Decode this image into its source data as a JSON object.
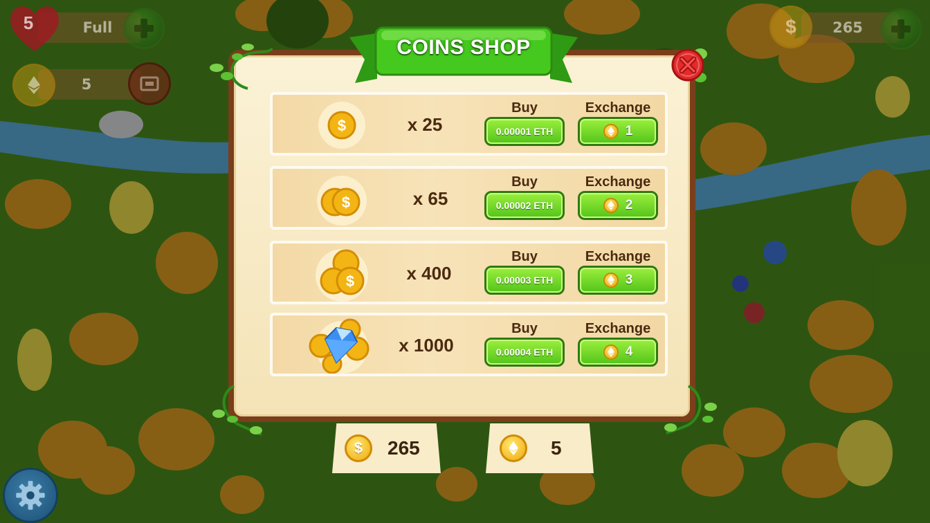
{
  "title": "COINS SHOP",
  "hud": {
    "lives": "5",
    "lives_status": "Full",
    "eth_tokens": "5",
    "coins": "265"
  },
  "shop": {
    "buy_header": "Buy",
    "exchange_header": "Exchange",
    "items": [
      {
        "quantity": "x 25",
        "buy_price": "0.00001 ETH",
        "exchange_cost": "1",
        "icon": "single-coin-icon"
      },
      {
        "quantity": "x 65",
        "buy_price": "0.00002 ETH",
        "exchange_cost": "2",
        "icon": "two-coins-icon"
      },
      {
        "quantity": "x 400",
        "buy_price": "0.00003 ETH",
        "exchange_cost": "3",
        "icon": "coin-pile-icon"
      },
      {
        "quantity": "x 1000",
        "buy_price": "0.00004 ETH",
        "exchange_cost": "4",
        "icon": "diamond-coins-icon"
      }
    ]
  },
  "balances": {
    "coins": "265",
    "eth_tokens": "5"
  },
  "colors": {
    "ribbon": "#3fbf1f",
    "button": "#6fd92a",
    "panel_frame": "#7a3e1a",
    "panel_fill": "#f8ecc9",
    "close": "#e22b2b"
  }
}
